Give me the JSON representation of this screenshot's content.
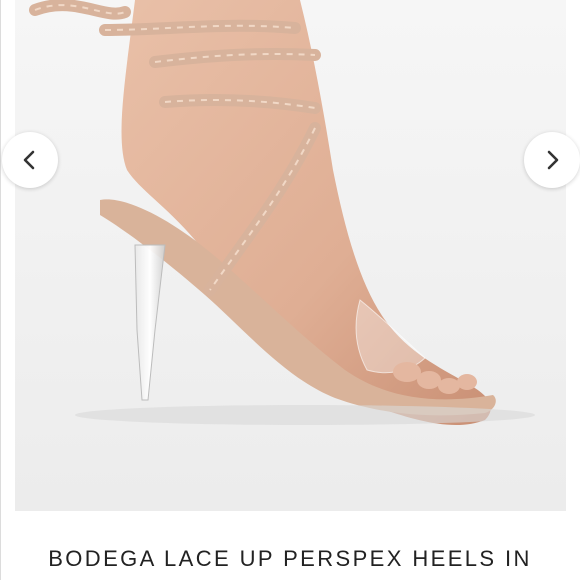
{
  "product": {
    "title": "BODEGA LACE UP PERSPEX HEELS IN"
  },
  "gallery": {
    "prev_icon": "chevron-left-icon",
    "next_icon": "chevron-right-icon"
  },
  "colors": {
    "background": "#ffffff",
    "photo_background": "#f2f2f2",
    "skin": "#e7bba4",
    "strap": "#dcb79e",
    "title_text": "#222222"
  }
}
